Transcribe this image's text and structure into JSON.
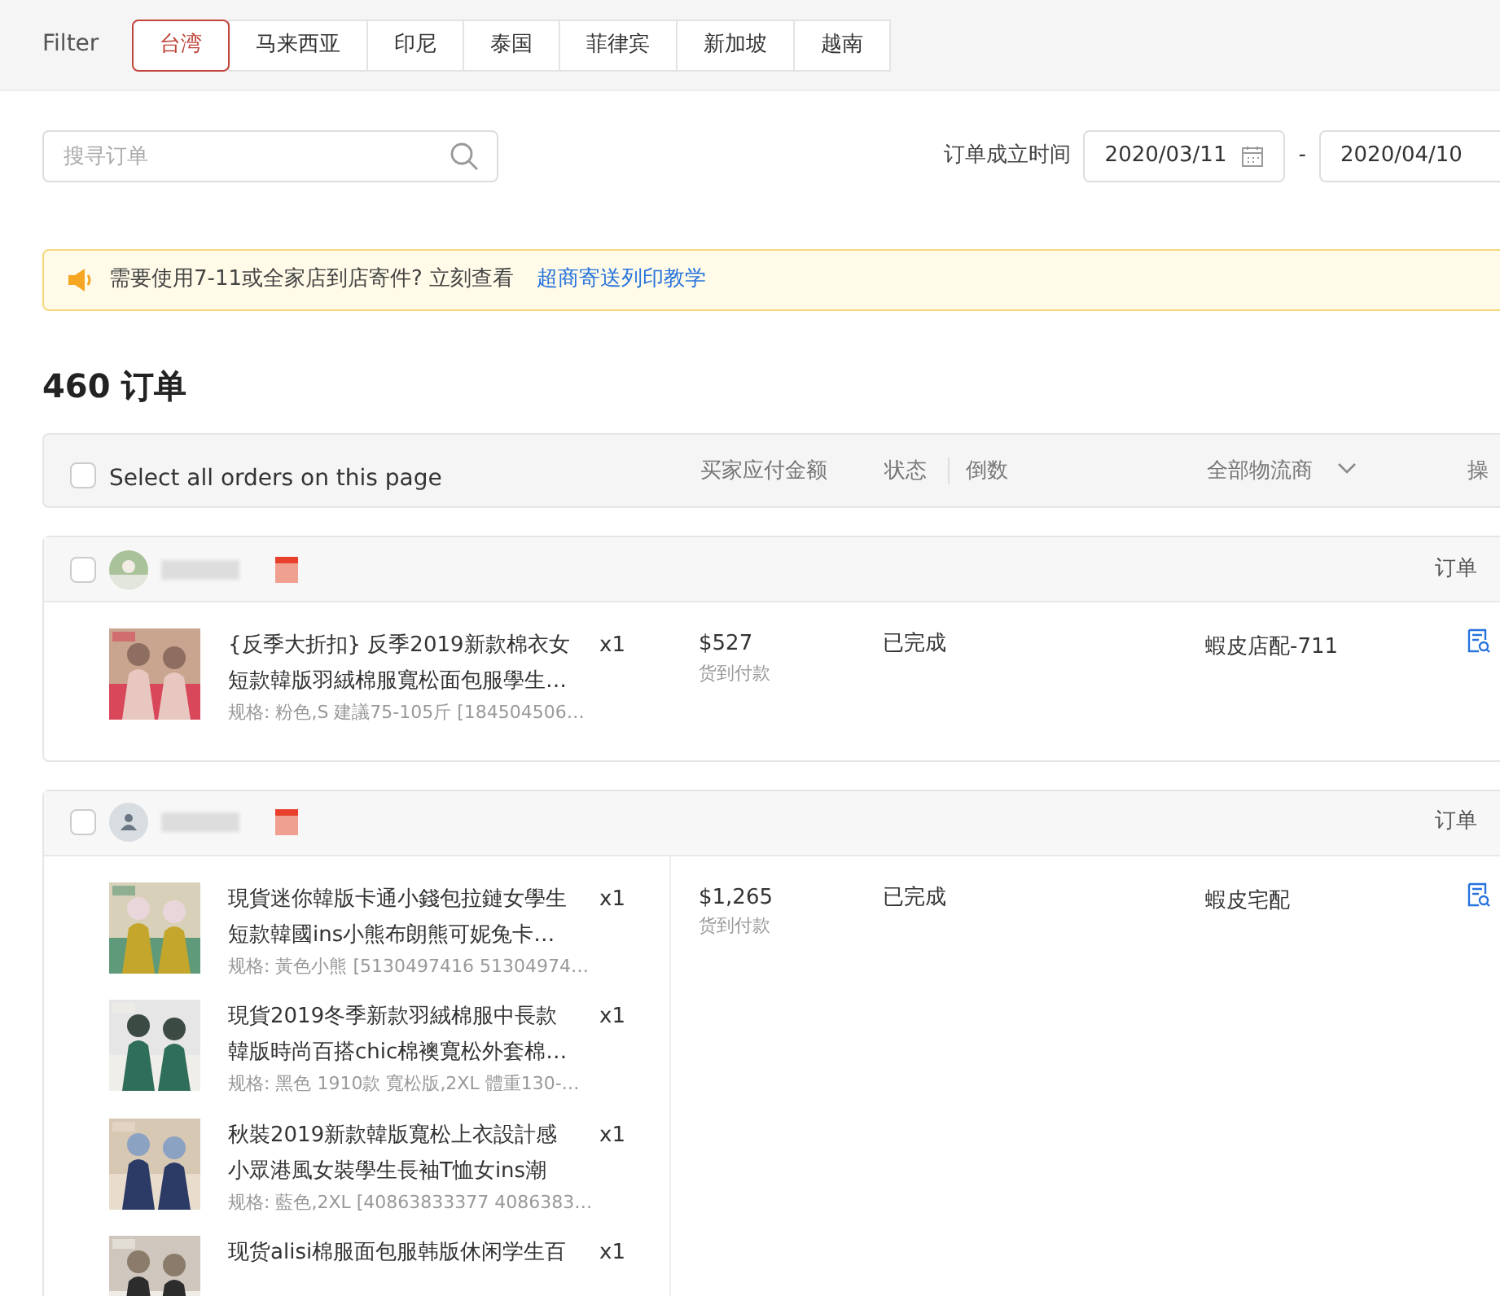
{
  "filter": {
    "label": "Filter",
    "tabs": [
      {
        "label": "台湾",
        "selected": true
      },
      {
        "label": "马来西亚",
        "selected": false
      },
      {
        "label": "印尼",
        "selected": false
      },
      {
        "label": "泰国",
        "selected": false
      },
      {
        "label": "菲律宾",
        "selected": false
      },
      {
        "label": "新加坡",
        "selected": false
      },
      {
        "label": "越南",
        "selected": false
      }
    ]
  },
  "search": {
    "placeholder": "搜寻订单"
  },
  "date_filter": {
    "label": "订单成立时间",
    "start": "2020/03/11",
    "separator": "-",
    "end": "2020/04/10"
  },
  "notice": {
    "text": "需要使用7-11或全家店到店寄件? 立刻查看",
    "link": "超商寄送列印教学"
  },
  "order_count": "460 订单",
  "table_header": {
    "select_all": "Select all orders on this page",
    "select_all_checked": false,
    "columns": [
      "买家应付金额",
      "状态",
      "倒数",
      "全部物流商",
      "操"
    ]
  },
  "orders": [
    {
      "checked": false,
      "avatar": {
        "kind": "picture"
      },
      "order_no_label": "订单",
      "amount": "$527",
      "payment": "货到付款",
      "status": "已完成",
      "logistics": "蝦皮店配-711",
      "products": [
        {
          "title_lines": [
            "{反季大折扣} 反季2019新款棉衣女",
            "短款韓版羽絨棉服寬松面包服學生…"
          ],
          "quantity": "x1",
          "spec": "规格: 粉色,S 建議75-105斤 [184504506…"
        }
      ]
    },
    {
      "checked": false,
      "avatar": {
        "kind": "generic"
      },
      "order_no_label": "订单",
      "amount": "$1,265",
      "payment": "货到付款",
      "status": "已完成",
      "logistics": "蝦皮宅配",
      "products": [
        {
          "title_lines": [
            "現貨迷你韓版卡通小錢包拉鏈女學生",
            "短款韓國ins小熊布朗熊可妮兔卡…"
          ],
          "quantity": "x1",
          "spec": "规格: 黃色小熊 [5130497416 51304974…"
        },
        {
          "title_lines": [
            "現貨2019冬季新款羽絨棉服中長款",
            "韓版時尚百搭chic棉襖寬松外套棉…"
          ],
          "quantity": "x1",
          "spec": "规格: 黑色 1910款 寬松版,2XL 體重130-…"
        },
        {
          "title_lines": [
            "秋裝2019新款韓版寬松上衣設計感",
            "小眾港風女裝學生長袖T恤女ins潮"
          ],
          "quantity": "x1",
          "spec": "规格: 藍色,2XL [40863833377 4086383…"
        },
        {
          "title_lines": [
            "现货alisi棉服面包服韩版休闲学生百"
          ],
          "quantity": "x1"
        }
      ]
    }
  ]
}
